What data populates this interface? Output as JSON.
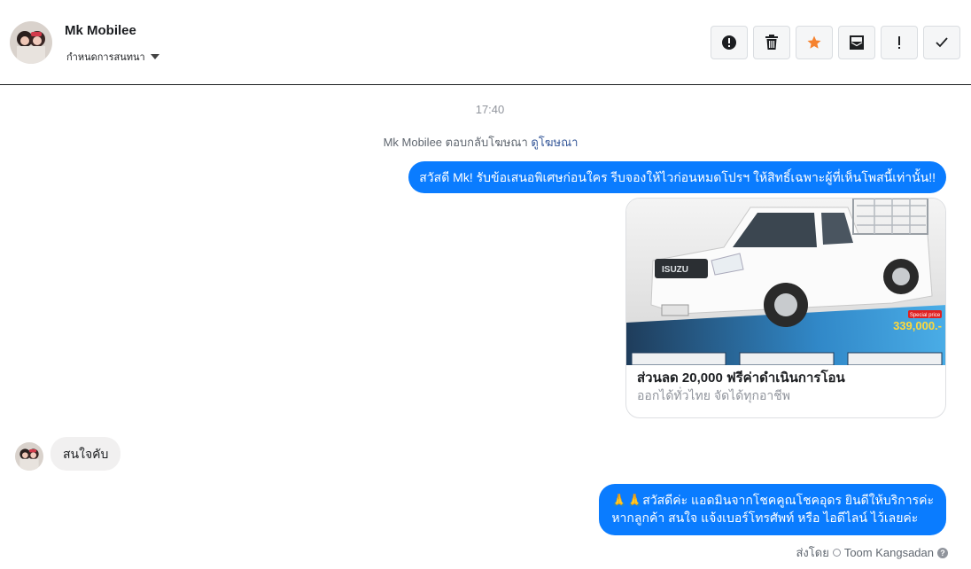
{
  "header": {
    "contact_name": "Mk Mobilee",
    "assign_label": "กำหนดการสนทนา",
    "actions": [
      {
        "name": "report-spam-button",
        "icon": "alert-circle-icon"
      },
      {
        "name": "delete-button",
        "icon": "trash-icon"
      },
      {
        "name": "star-button",
        "icon": "star-icon"
      },
      {
        "name": "mark-unread-button",
        "icon": "envelope-icon"
      },
      {
        "name": "follow-up-button",
        "icon": "exclamation-icon"
      },
      {
        "name": "mark-done-button",
        "icon": "checkmark-icon"
      }
    ]
  },
  "thread": {
    "timestamp": "17:40",
    "ad_reply_prefix": "Mk Mobilee ตอบกลับโฆษณา",
    "ad_reply_link": "ดูโฆษณา",
    "outgoing_1": "สวัสดี Mk! รับข้อเสนอพิเศษก่อนใคร รีบจองให้ไวก่อนหมดโปรฯ ให้สิทธิ์เฉพาะผู้ที่เห็นโพสนี้เท่านั้น!!",
    "ad_card": {
      "title": "ส่วนลด 20,000 ฟรีค่าดำเนินการโอน",
      "subtitle": "ออกได้ทั่วไทย จัดได้ทุกอาชีพ",
      "brand_text": "ISUZU",
      "price_tag": "Special price",
      "price": "339,000.-"
    },
    "incoming_1": "สนใจคับ",
    "outgoing_2_line1": "🙏🙏สวัสดีค่ะ แอดมินจากโชคคูณโชคอุดร ยินดีให้บริการค่ะ",
    "outgoing_2_line2": "หากลูกค้า สนใจ แจ้งเบอร์โทรศัพท์ หรือ ไอดีไลน์  ไว้เลยค่ะ",
    "sent_by_label": "ส่งโดย",
    "sent_by_name": "Toom Kangsadan"
  },
  "colors": {
    "accent": "#0a7cff",
    "star": "#f5822e",
    "link": "#365899"
  }
}
